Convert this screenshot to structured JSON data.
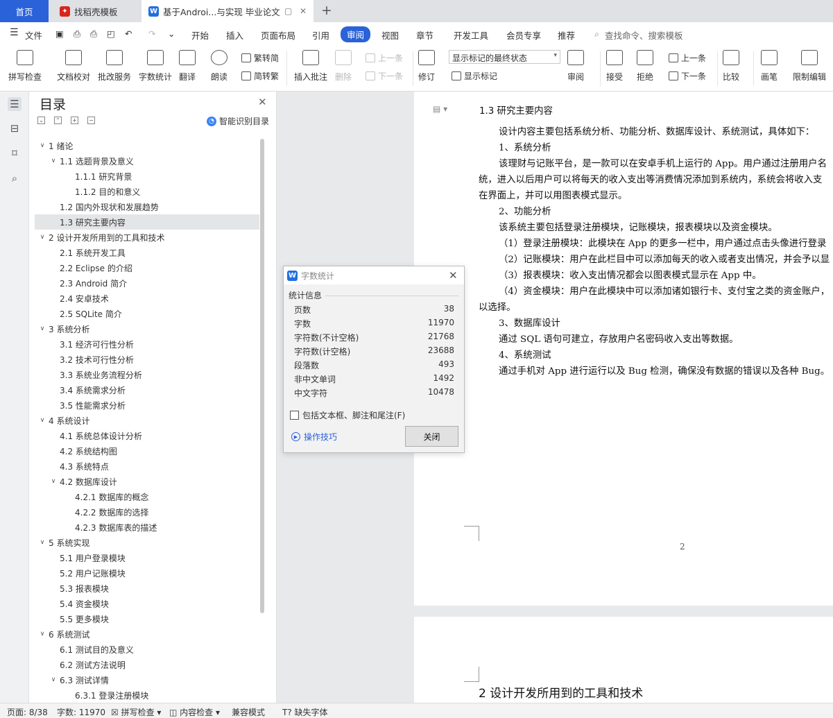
{
  "tabs": {
    "home": "首页",
    "t1": "找稻壳模板",
    "t2": "基于Androi...与实现 毕业论文",
    "new_tab": "+"
  },
  "menu": {
    "file": "文件",
    "items": [
      "开始",
      "插入",
      "页面布局",
      "引用",
      "审阅",
      "视图",
      "章节",
      "开发工具",
      "会员专享",
      "推荐"
    ],
    "active": "审阅",
    "search": "查找命令、搜索模板"
  },
  "ribbon": {
    "spell": "拼写检查",
    "proof": "文档校对",
    "batch": "批改服务",
    "wordcount": "字数统计",
    "translate": "翻译",
    "read": "朗读",
    "trad": "繁转简",
    "simp": "简转繁",
    "comment": "插入批注",
    "delete": "删除",
    "prev": "上一条",
    "next": "下一条",
    "revise": "修订",
    "markup_select": "显示标记的最终状态",
    "show_marks": "显示标记",
    "review": "审阅",
    "accept": "接受",
    "reject": "拒绝",
    "prev2": "上一条",
    "next2": "下一条",
    "compare": "比较",
    "pen": "画笔",
    "restrict": "限制编辑"
  },
  "toc": {
    "title": "目录",
    "smart": "智能识别目录",
    "items": [
      {
        "text": "1 绪论",
        "level": 1,
        "expand": true
      },
      {
        "text": "1.1 选题背景及意义",
        "level": 2,
        "expand": true
      },
      {
        "text": "1.1.1  研究背景",
        "level": 3
      },
      {
        "text": "1.1.2  目的和意义",
        "level": 3
      },
      {
        "text": "1.2 国内外现状和发展趋势",
        "level": 2
      },
      {
        "text": "1.3  研究主要内容",
        "level": 2,
        "selected": true
      },
      {
        "text": "2 设计开发所用到的工具和技术",
        "level": 1,
        "expand": true
      },
      {
        "text": "2.1 系统开发工具",
        "level": 2
      },
      {
        "text": "2.2 Eclipse 的介绍",
        "level": 2
      },
      {
        "text": "2.3 Android 简介",
        "level": 2
      },
      {
        "text": "2.4 安卓技术",
        "level": 2
      },
      {
        "text": "2.5 SQLite 简介",
        "level": 2
      },
      {
        "text": "3 系统分析",
        "level": 1,
        "expand": true
      },
      {
        "text": "3.1  经济可行性分析",
        "level": 2
      },
      {
        "text": "3.2  技术可行性分析",
        "level": 2
      },
      {
        "text": "3.3  系统业务流程分析",
        "level": 2
      },
      {
        "text": "3.4  系统需求分析",
        "level": 2
      },
      {
        "text": "3.5  性能需求分析",
        "level": 2
      },
      {
        "text": "4 系统设计",
        "level": 1,
        "expand": true
      },
      {
        "text": "4.1 系统总体设计分析",
        "level": 2
      },
      {
        "text": "4.2 系统结构图",
        "level": 2
      },
      {
        "text": "4.3 系统特点",
        "level": 2
      },
      {
        "text": "4.2 数据库设计",
        "level": 2,
        "expand": true
      },
      {
        "text": "4.2.1 数据库的概念",
        "level": 3
      },
      {
        "text": "4.2.2 数据库的选择",
        "level": 3
      },
      {
        "text": "4.2.3 数据库表的描述",
        "level": 3
      },
      {
        "text": "5 系统实现",
        "level": 1,
        "expand": true
      },
      {
        "text": "5.1 用户登录模块",
        "level": 2
      },
      {
        "text": "5.2 用户记账模块",
        "level": 2
      },
      {
        "text": "5.3 报表模块",
        "level": 2
      },
      {
        "text": "5.4 资金模块",
        "level": 2
      },
      {
        "text": "5.5 更多模块",
        "level": 2
      },
      {
        "text": "6 系统测试",
        "level": 1,
        "expand": true
      },
      {
        "text": "6.1 测试目的及意义",
        "level": 2
      },
      {
        "text": "6.2 测试方法说明",
        "level": 2
      },
      {
        "text": "6.3 测试详情",
        "level": 2,
        "expand": true
      },
      {
        "text": "6.3.1  登录注册模块",
        "level": 3
      }
    ]
  },
  "doc": {
    "heading": "1.3  研究主要内容",
    "lines": [
      "设计内容主要包括系统分析、功能分析、数据库设计、系统测试，具体如下：",
      "1、系统分析",
      "该理财与记账平台，是一款可以在安卓手机上运行的 App。用户通过注册用户名",
      "统，进入以后用户可以将每天的收入支出等消费情况添加到系统内，系统会将收入支",
      "在界面上，并可以用图表模式显示。",
      "2、功能分析",
      "该系统主要包括登录注册模块，记账模块，报表模块以及资金模块。",
      "（1）登录注册模块：此模块在 App 的更多一栏中，用户通过点击头像进行登录",
      "（2）记账模块：用户在此栏目中可以添加每天的收入或者支出情况，并会予以显",
      "（3）报表模块：收入支出情况都会以图表模式显示在 App 中。",
      "（4）资金模块：用户在此模块中可以添加诸如银行卡、支付宝之类的资金账户，",
      "以选择。",
      "3、数据库设计",
      "通过 SQL 语句可建立，存放用户名密码收入支出等数据。",
      "4、系统测试",
      "通过手机对 App 进行运行以及 Bug 检测，确保没有数据的错误以及各种 Bug。"
    ],
    "page_number": "2",
    "next_heading": "2 设计开发所用到的工具和技术"
  },
  "dialog": {
    "title": "字数统计",
    "section": "统计信息",
    "stats": [
      {
        "label": "页数",
        "value": "38"
      },
      {
        "label": "字数",
        "value": "11970"
      },
      {
        "label": "字符数(不计空格)",
        "value": "21768"
      },
      {
        "label": "字符数(计空格)",
        "value": "23688"
      },
      {
        "label": "段落数",
        "value": "493"
      },
      {
        "label": "非中文单词",
        "value": "1492"
      },
      {
        "label": "中文字符",
        "value": "10478"
      }
    ],
    "checkbox": "包括文本框、脚注和尾注(F)",
    "tips": "操作技巧",
    "close": "关闭"
  },
  "status": {
    "page": "页面: 8/38",
    "words": "字数: 11970",
    "spell": "拼写检查",
    "content": "内容检查",
    "compat": "兼容模式",
    "font": "缺失字体"
  },
  "colors": {
    "accent": "#2a62d9",
    "wps_red": "#d9261c",
    "wps_blue": "#1f6fe0"
  }
}
